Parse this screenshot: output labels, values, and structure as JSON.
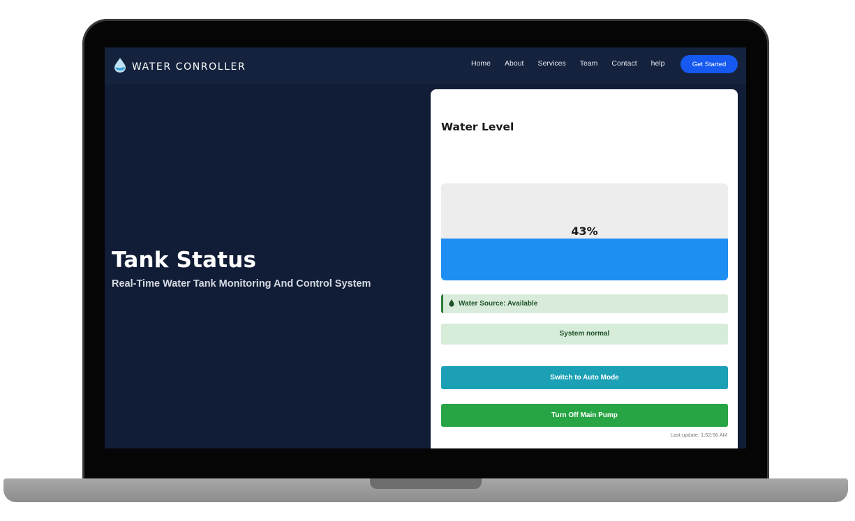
{
  "navbar": {
    "brand": "WATER CONROLLER",
    "links": [
      "Home",
      "About",
      "Services",
      "Team",
      "Contact",
      "help"
    ],
    "cta_label": "Get Started"
  },
  "hero": {
    "title": "Tank Status",
    "subtitle": "Real-Time Water Tank Monitoring And Control System"
  },
  "card": {
    "title": "Water Level",
    "level_percent": 43,
    "level_label": "43%",
    "water_source": "Water Source: Available",
    "system_status": "System normal",
    "auto_mode_button": "Switch to Auto Mode",
    "pump_button": "Turn Off Main Pump",
    "last_update": "Last update: 1:52:56 AM"
  },
  "colors": {
    "accent": "#1559f0",
    "water": "#1f8ef3",
    "auto_button": "#1ba0b5",
    "pump_button": "#27a544",
    "status_bg": "#d7ecd9"
  },
  "icons": {
    "brand": "water-drop-logo-icon",
    "source": "water-drop-icon"
  }
}
